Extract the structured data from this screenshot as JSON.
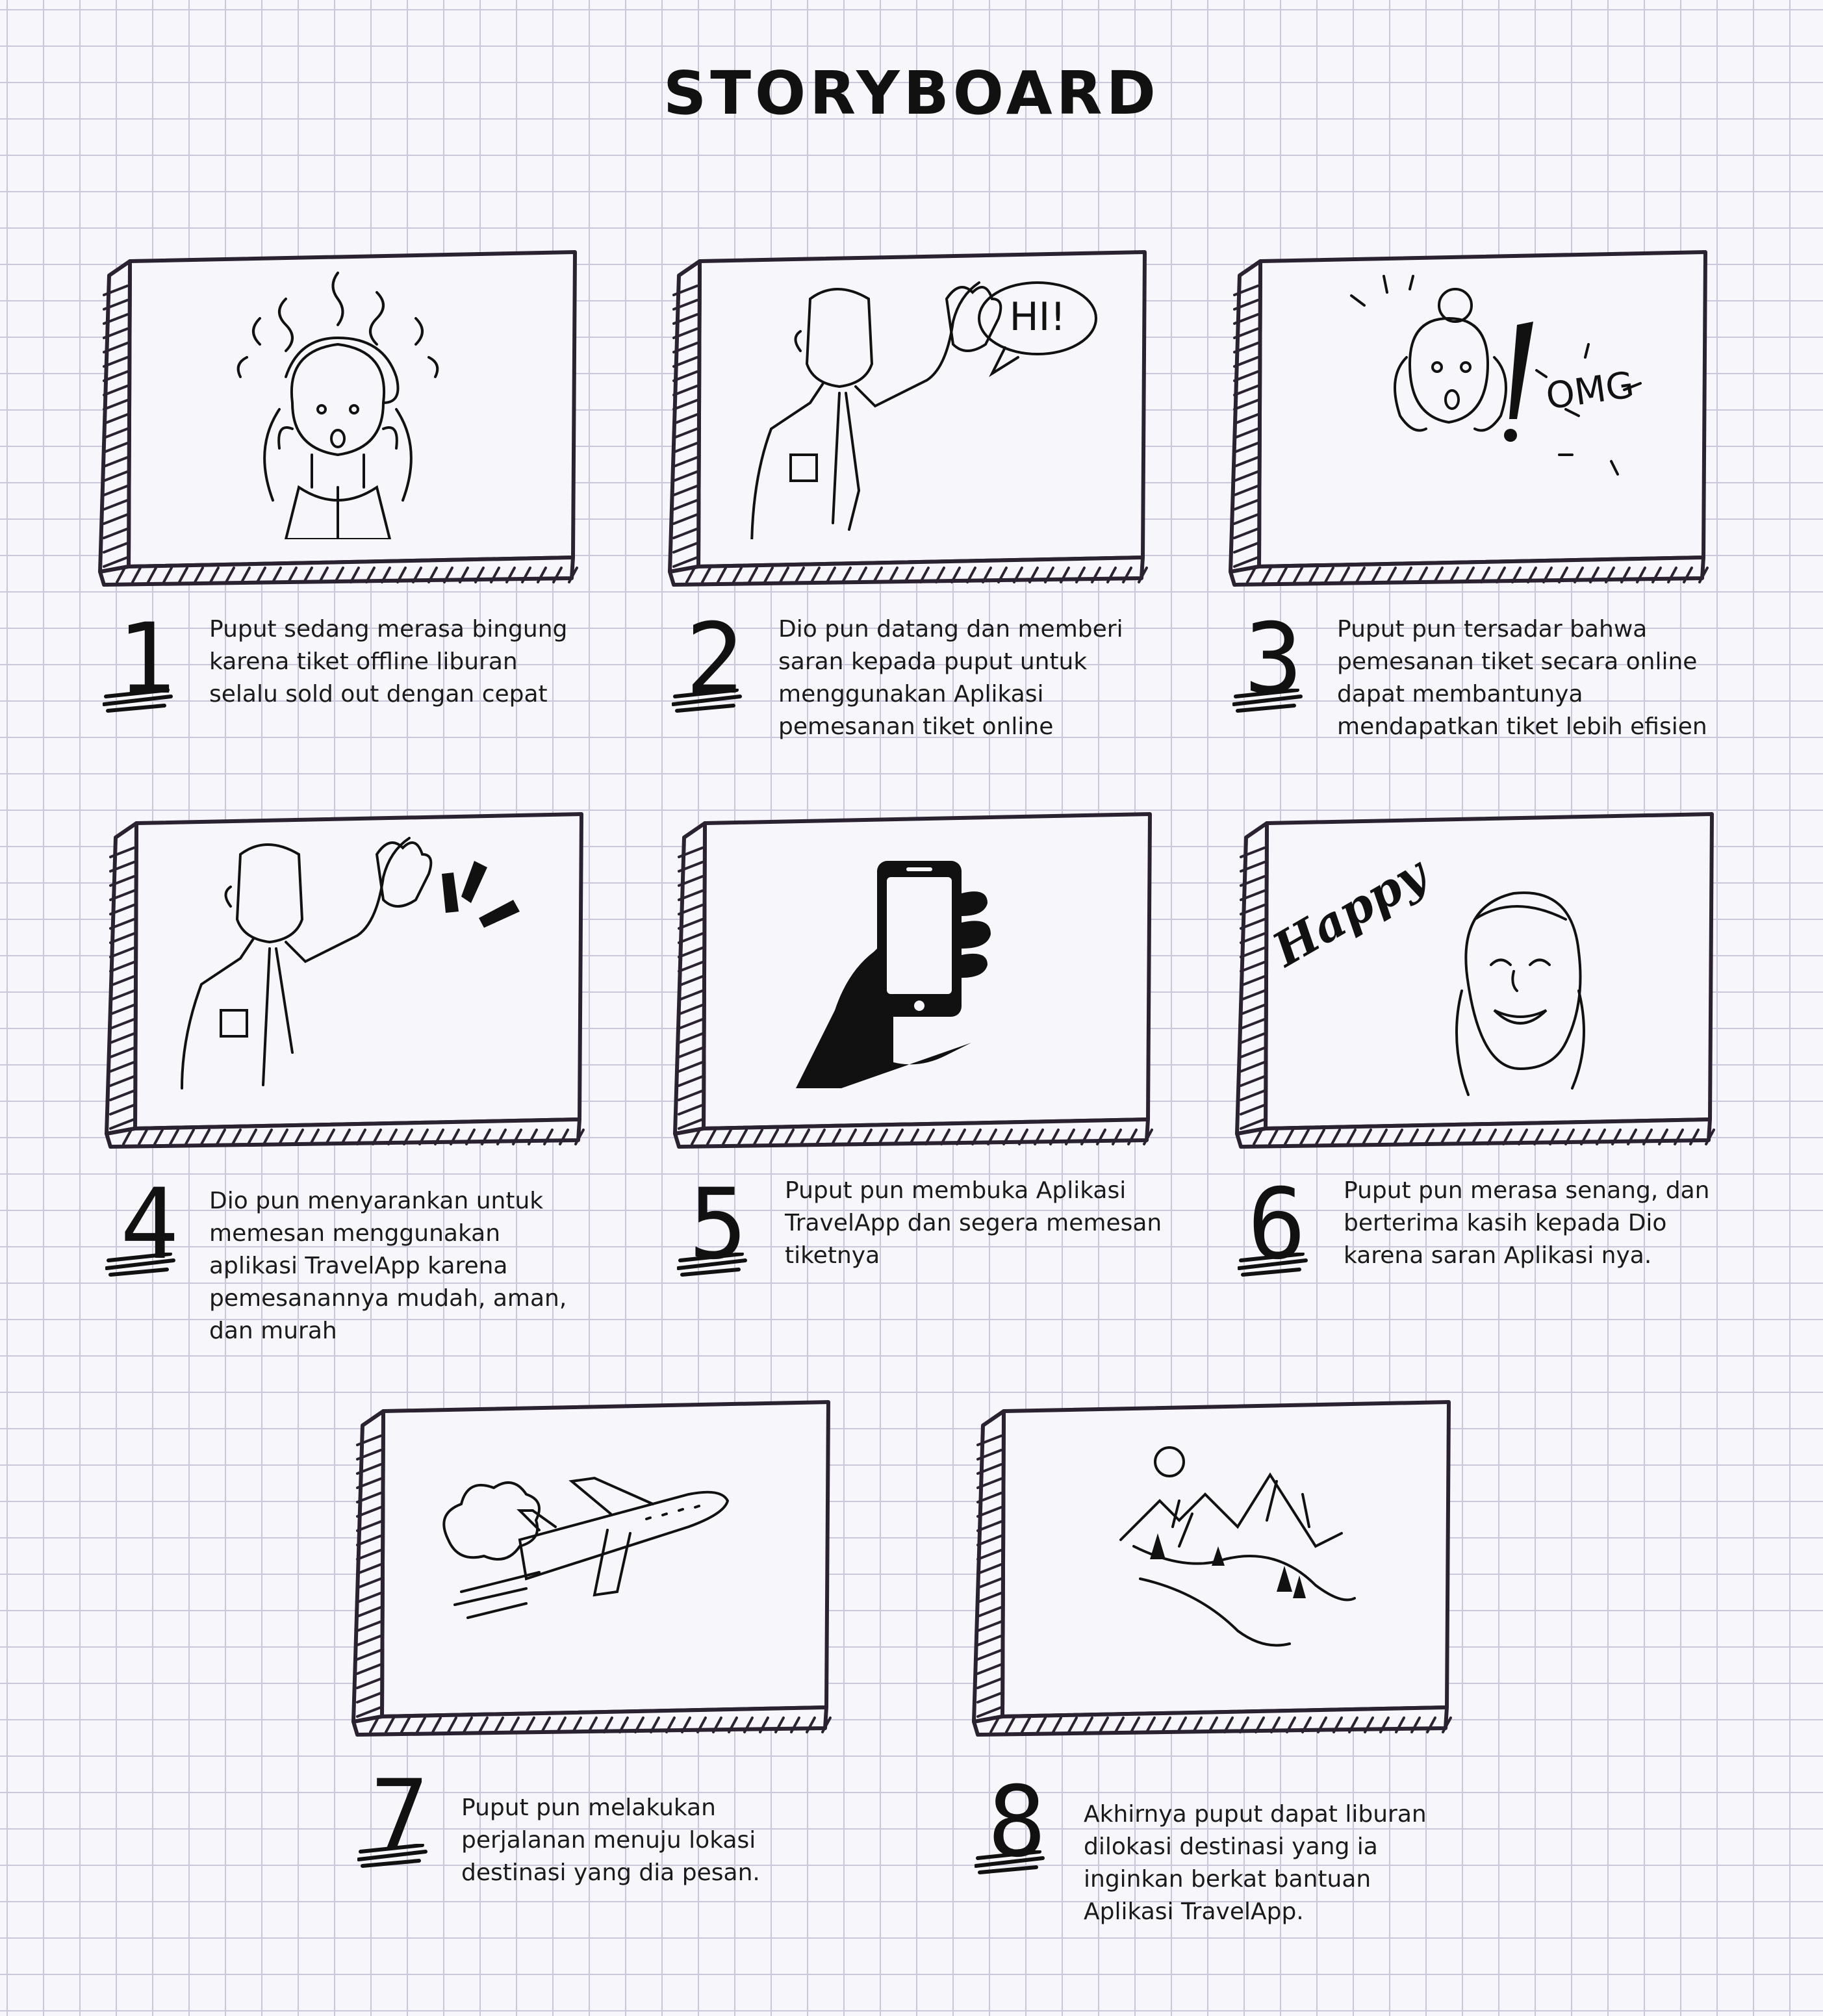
{
  "title": "STORYBOARD",
  "panels": [
    {
      "number": "1",
      "caption": "Puput sedang merasa bingung karena tiket offline liburan selalu sold out dengan cepat",
      "illustration": "stressed-woman"
    },
    {
      "number": "2",
      "caption": "Dio pun datang dan memberi saran kepada puput untuk menggunakan Aplikasi pemesanan tiket online",
      "illustration": "man-saying-hi",
      "bubble_text": "HI!"
    },
    {
      "number": "3",
      "caption": "Puput pun tersadar bahwa pemesanan tiket secara online dapat membantunya mendapatkan tiket lebih efisien",
      "illustration": "surprised-woman",
      "exclaim_text": "OMG"
    },
    {
      "number": "4",
      "caption": "Dio pun menyarankan untuk memesan menggunakan aplikasi TravelApp karena pemesanannya mudah, aman, dan murah",
      "illustration": "man-waving"
    },
    {
      "number": "5",
      "caption": "Puput pun membuka Aplikasi TravelApp dan segera memesan tiketnya",
      "illustration": "hand-holding-phone"
    },
    {
      "number": "6",
      "caption": "Puput pun merasa senang, dan berterima kasih kepada Dio karena saran Aplikasi nya.",
      "illustration": "happy-woman",
      "script_text": "Happy"
    },
    {
      "number": "7",
      "caption": "Puput pun melakukan perjalanan menuju lokasi destinasi yang dia pesan.",
      "illustration": "airplane"
    },
    {
      "number": "8",
      "caption": "Akhirnya puput dapat liburan dilokasi destinasi yang ia inginkan berkat bantuan Aplikasi TravelApp.",
      "illustration": "mountains"
    }
  ]
}
